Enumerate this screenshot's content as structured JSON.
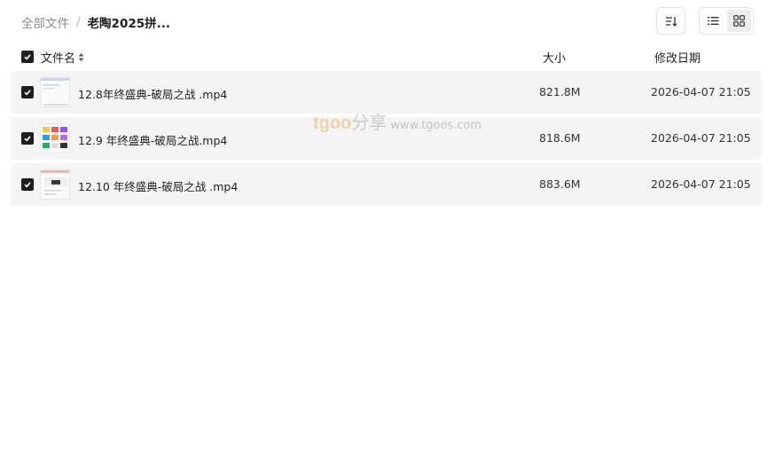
{
  "breadcrumb": {
    "root": "全部文件",
    "separator": "/",
    "current": "老陶2025拼..."
  },
  "columns": {
    "name": "文件名",
    "size": "大小",
    "modified": "修改日期"
  },
  "files": [
    {
      "name": "12.8年终盛典-破局之战 .mp4",
      "size": "821.8M",
      "modified": "2026-04-07 21:05",
      "checked": true
    },
    {
      "name": "12.9 年终盛典-破局之战.mp4",
      "size": "818.6M",
      "modified": "2026-04-07 21:05",
      "checked": true
    },
    {
      "name": "12.10 年终盛典-破局之战 .mp4",
      "size": "883.6M",
      "modified": "2026-04-07 21:05",
      "checked": true
    }
  ],
  "watermark": {
    "brand": "tgoo",
    "share": "分享",
    "url": "www.tgoos.com"
  },
  "icons": {
    "sort": "sort-icon",
    "list_view": "list-view-icon",
    "grid_view": "grid-view-icon",
    "checkbox": "checkmark-icon",
    "sort_indicator": "sort-arrows-icon"
  },
  "colors": {
    "row_bg": "#f4f4f4",
    "checkbox": "#1f1f1f",
    "muted_text": "#8a8a8a",
    "watermark_brand": "#f2b36b"
  }
}
